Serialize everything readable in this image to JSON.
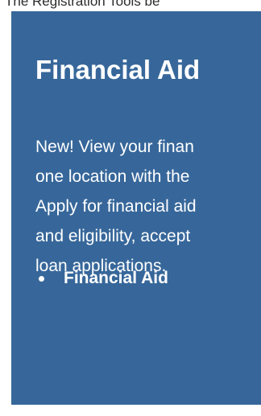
{
  "top_text": "The Registration Tools be",
  "panel": {
    "title": "Financial Aid",
    "body_lines": [
      "New! View your finan",
      "one location with the",
      "Apply for financial aid",
      "and eligibility, accept",
      "loan applications."
    ],
    "links": [
      {
        "label": "Financial Aid"
      }
    ],
    "colors": {
      "panel_bg": "#37679a",
      "text": "#ffffff"
    }
  }
}
